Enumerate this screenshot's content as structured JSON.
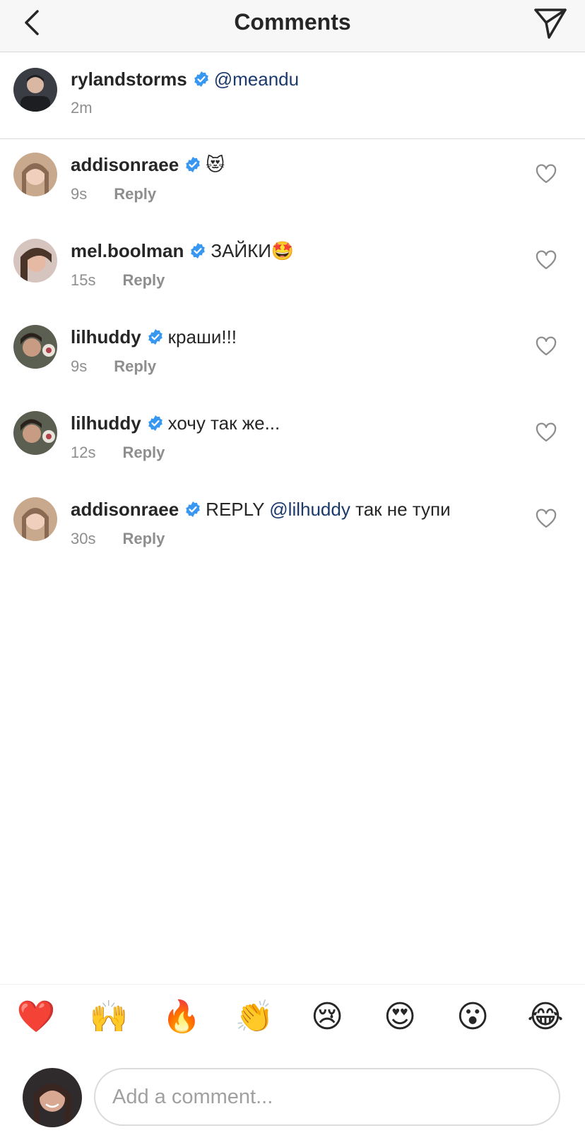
{
  "header": {
    "title": "Comments"
  },
  "caption": {
    "username": "rylandstorms",
    "mention": "@meandu",
    "time": "2m"
  },
  "comments": [
    {
      "username": "addisonraee",
      "text": "😻",
      "time": "9s",
      "reply_label": "Reply"
    },
    {
      "username": "mel.boolman",
      "text": "ЗАЙКИ🤩",
      "time": "15s",
      "reply_label": "Reply"
    },
    {
      "username": "lilhuddy",
      "text": "краши!!!",
      "time": "9s",
      "reply_label": "Reply"
    },
    {
      "username": "lilhuddy",
      "text": "хочу так же...",
      "time": "12s",
      "reply_label": "Reply"
    },
    {
      "username": "addisonraee",
      "text_prefix": "REPLY",
      "mention": "@lilhuddy",
      "text_suffix": "так не тупи",
      "time": "30s",
      "reply_label": "Reply"
    }
  ],
  "emoji_bar": [
    "❤️",
    "🙌",
    "🔥",
    "👏",
    "😢",
    "😍",
    "😮",
    "😂"
  ],
  "input": {
    "placeholder": "Add a comment..."
  },
  "colors": {
    "verified": "#3897f0",
    "mention": "#1b3a6b",
    "meta": "#8e8e8e"
  }
}
